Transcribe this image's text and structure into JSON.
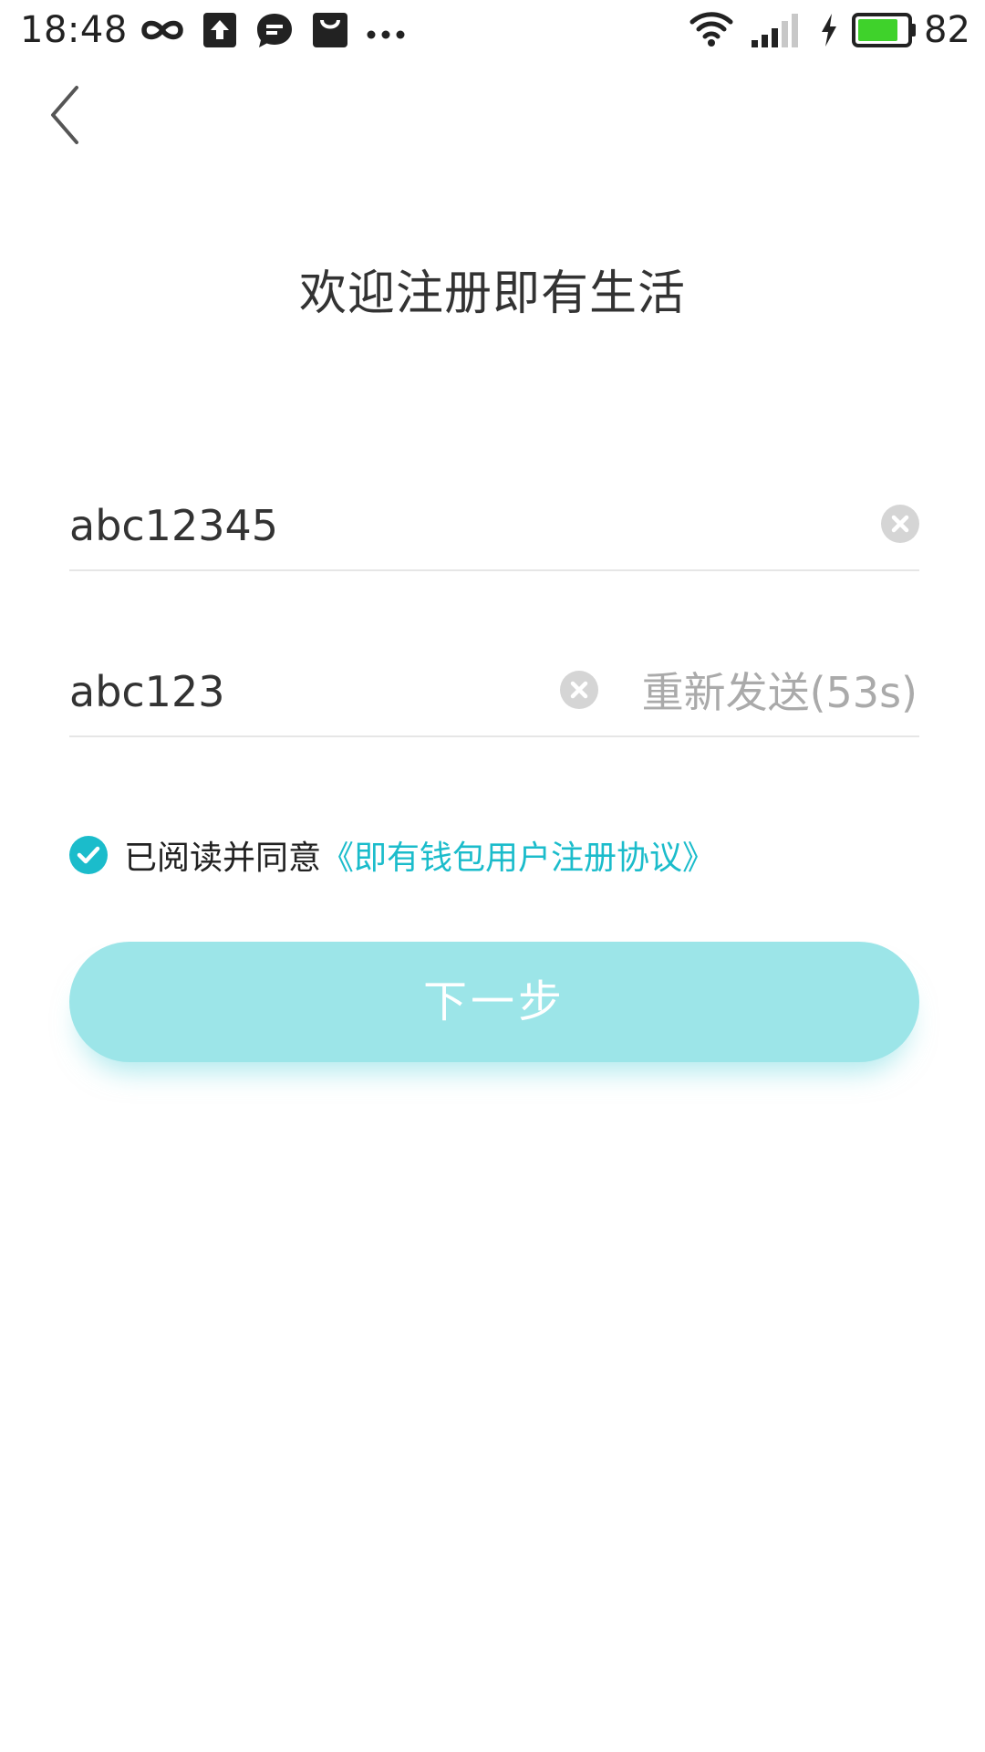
{
  "status_bar": {
    "time": "18:48",
    "battery_percent": "82",
    "battery_level": 0.82,
    "icons": [
      "infinity-icon",
      "upload-icon",
      "chat-icon",
      "shopping-bag-icon",
      "more-dots-icon",
      "wifi-icon",
      "signal-icon",
      "charging-icon",
      "battery-icon"
    ]
  },
  "header": {
    "back_icon": "chevron-left-icon"
  },
  "page": {
    "title": "欢迎注册即有生活"
  },
  "form": {
    "account_value": "abc12345",
    "code_value": "abc123",
    "resend_label": "重新发送(53s)",
    "clear_icon": "clear-circle-icon"
  },
  "agreement": {
    "checked": true,
    "text": "已阅读并同意",
    "link": "《即有钱包用户注册协议》"
  },
  "actions": {
    "next_label": "下一步"
  },
  "colors": {
    "accent": "#1bbccb",
    "button_disabled": "#9ce5e8",
    "battery_fill": "#3fd22b"
  }
}
